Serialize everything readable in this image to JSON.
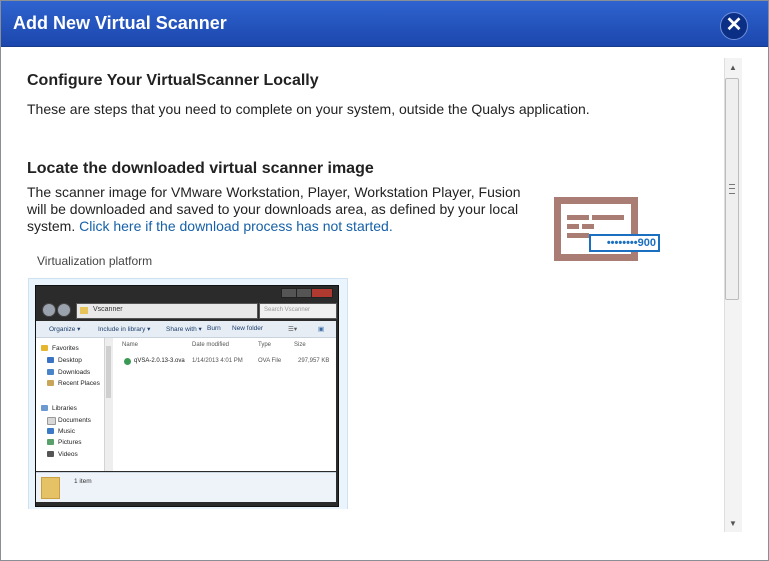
{
  "dialog": {
    "title": "Add New Virtual Scanner",
    "close_glyph": "✕"
  },
  "section1": {
    "heading": "Configure Your VirtualScanner Locally",
    "text": "These are steps that you need to complete on your system, outside the Qualys application."
  },
  "section2": {
    "heading": "Locate the downloaded virtual scanner image",
    "text_line1": "The scanner image for VMware Workstation, Player, Workstation Player, Fusion",
    "text_line2": "will be downloaded and saved to your downloads area, as defined by your local",
    "text_line3_prefix": "system. ",
    "link": "Click here if the download process has not started."
  },
  "scanner_icon": {
    "name": "virtual-scanner-icon",
    "password_mask": "••••••••900",
    "color": "#a97c74"
  },
  "panel": {
    "label": "Virtualization platform"
  },
  "explorer": {
    "address": "Vscanner",
    "search_placeholder": "Search Vscanner",
    "toolbar": [
      "Organize ▾",
      "Include in library ▾",
      "Share with ▾",
      "Burn",
      "New folder"
    ],
    "nav_items": [
      {
        "label": "Favorites",
        "icon": "star-icon"
      },
      {
        "label": "Desktop",
        "icon": "desktop-icon"
      },
      {
        "label": "Downloads",
        "icon": "downloads-icon"
      },
      {
        "label": "Recent Places",
        "icon": "recent-icon"
      },
      {
        "label": "Libraries",
        "icon": "libraries-icon"
      },
      {
        "label": "Documents",
        "icon": "documents-icon"
      },
      {
        "label": "Music",
        "icon": "music-icon"
      },
      {
        "label": "Pictures",
        "icon": "pictures-icon"
      },
      {
        "label": "Videos",
        "icon": "videos-icon"
      }
    ],
    "columns": [
      "Name",
      "Date modified",
      "Type",
      "Size"
    ],
    "file": {
      "name": "qVSA-2.0.13-3.ova",
      "date": "1/14/2013 4:01 PM",
      "type": "OVA File",
      "size": "297,957 KB"
    },
    "status": "1 item"
  }
}
